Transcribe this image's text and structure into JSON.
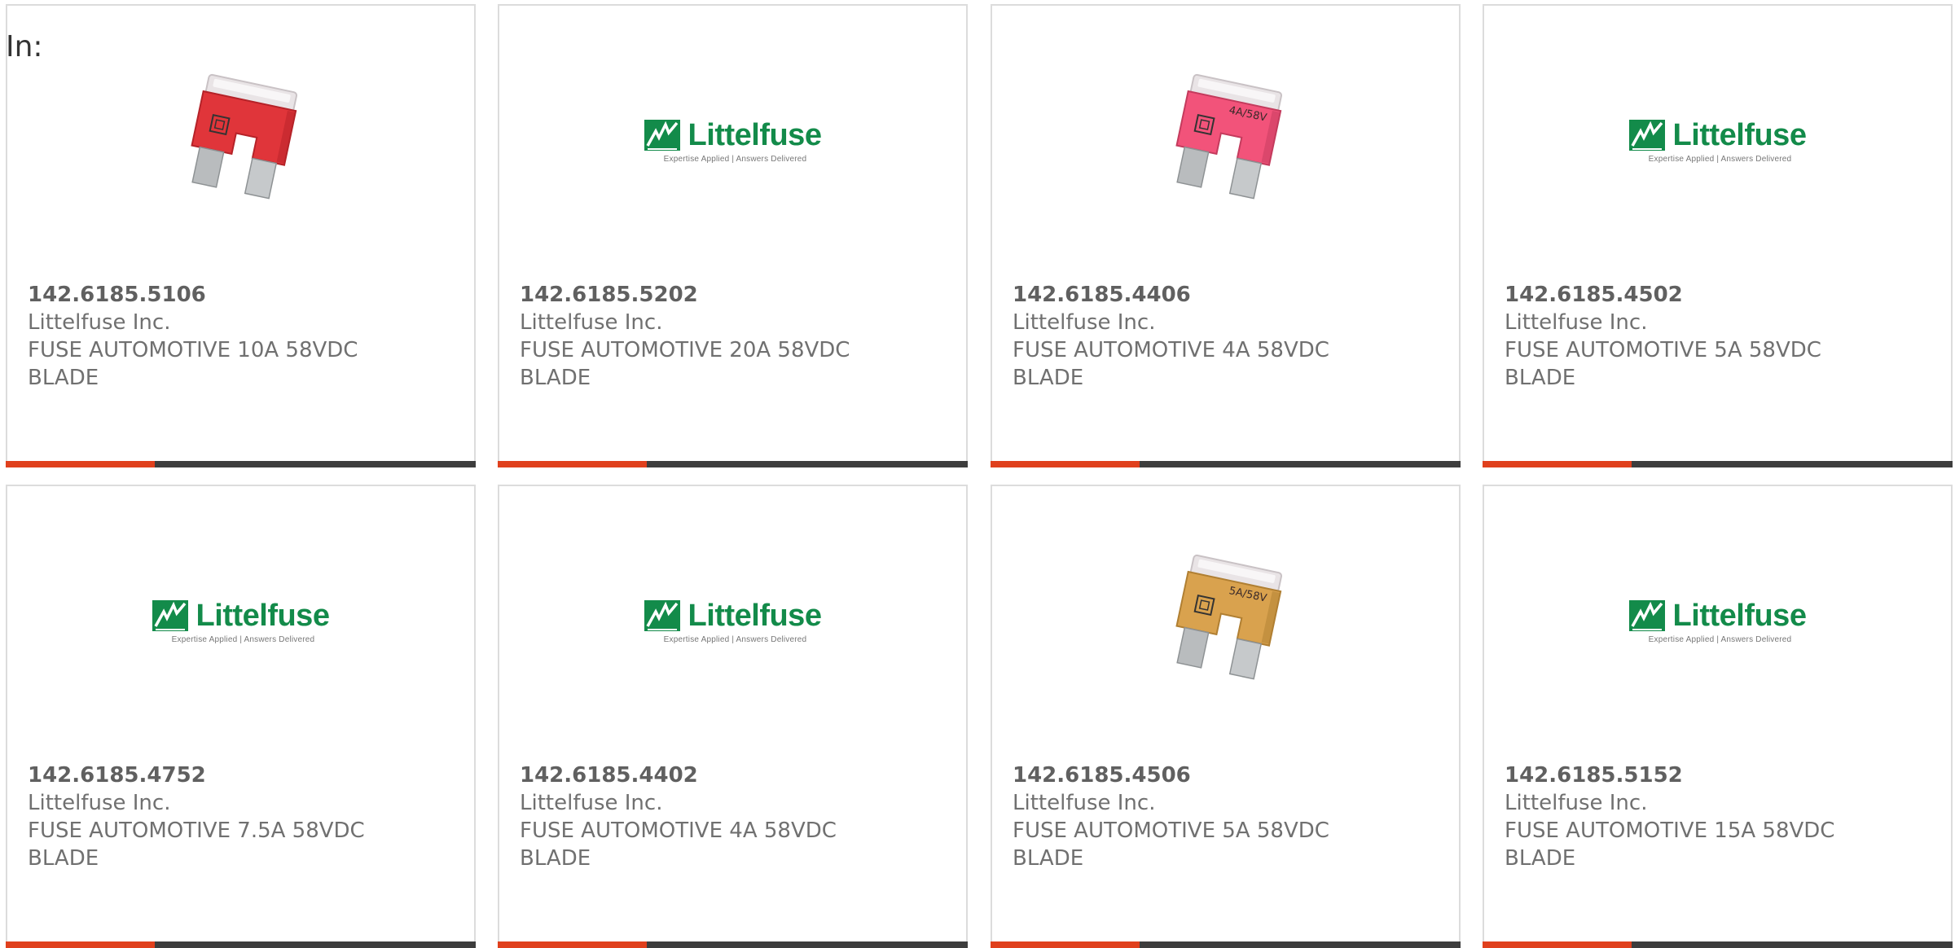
{
  "header": {
    "label": "In:"
  },
  "logo": {
    "wordmark": "Littelfuse",
    "tagline": "Expertise Applied | Answers Delivered"
  },
  "colors": {
    "accent": "#e0401d",
    "bar": "#3d3d3d",
    "brand_green": "#138b4a",
    "fuse_red": "#e0353a",
    "fuse_pink": "#f2537a",
    "fuse_tan": "#d9a24e"
  },
  "products": [
    {
      "part_number": "142.6185.5106",
      "manufacturer": "Littelfuse Inc.",
      "description": "FUSE AUTOMOTIVE 10A 58VDC\nBLADE",
      "image": "red-blade-fuse",
      "fuse_label": ""
    },
    {
      "part_number": "142.6185.5202",
      "manufacturer": "Littelfuse Inc.",
      "description": "FUSE AUTOMOTIVE 20A 58VDC\nBLADE",
      "image": "littelfuse-logo",
      "fuse_label": ""
    },
    {
      "part_number": "142.6185.4406",
      "manufacturer": "Littelfuse Inc.",
      "description": "FUSE AUTOMOTIVE 4A 58VDC\nBLADE",
      "image": "pink-blade-fuse",
      "fuse_label": "4A/58V"
    },
    {
      "part_number": "142.6185.4502",
      "manufacturer": "Littelfuse Inc.",
      "description": "FUSE AUTOMOTIVE 5A 58VDC\nBLADE",
      "image": "littelfuse-logo",
      "fuse_label": ""
    },
    {
      "part_number": "142.6185.4752",
      "manufacturer": "Littelfuse Inc.",
      "description": "FUSE AUTOMOTIVE 7.5A 58VDC\nBLADE",
      "image": "littelfuse-logo",
      "fuse_label": ""
    },
    {
      "part_number": "142.6185.4402",
      "manufacturer": "Littelfuse Inc.",
      "description": "FUSE AUTOMOTIVE 4A 58VDC\nBLADE",
      "image": "littelfuse-logo",
      "fuse_label": ""
    },
    {
      "part_number": "142.6185.4506",
      "manufacturer": "Littelfuse Inc.",
      "description": "FUSE AUTOMOTIVE 5A 58VDC\nBLADE",
      "image": "tan-blade-fuse",
      "fuse_label": "5A/58V"
    },
    {
      "part_number": "142.6185.5152",
      "manufacturer": "Littelfuse Inc.",
      "description": "FUSE AUTOMOTIVE 15A 58VDC\nBLADE",
      "image": "littelfuse-logo",
      "fuse_label": ""
    }
  ]
}
